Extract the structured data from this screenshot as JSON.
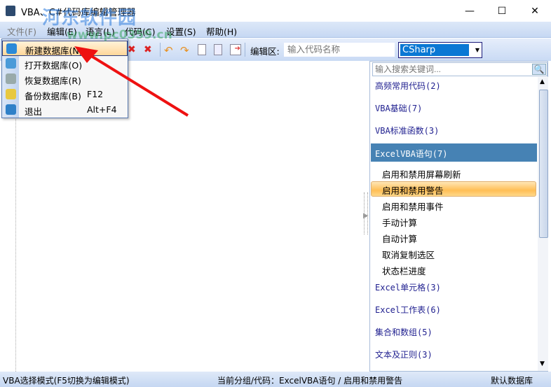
{
  "window": {
    "title": "VBA、C#代码库编辑管理器",
    "minimize": "—",
    "maximize": "☐",
    "close": "✕"
  },
  "watermark": {
    "name": "河东软件园",
    "url": "www.pc0359.cn"
  },
  "menu": [
    "文件(F)",
    "编辑(E)",
    "语言(L)",
    "代码(C)",
    "设置(S)",
    "帮助(H)"
  ],
  "toolbar": {
    "edit_label": "编辑区:",
    "code_placeholder": "输入代码名称",
    "language": "CSharp"
  },
  "file_menu": [
    {
      "label": "新建数据库(N)",
      "shortcut": ""
    },
    {
      "label": "打开数据库(O)",
      "shortcut": ""
    },
    {
      "label": "恢复数据库(R)",
      "shortcut": ""
    },
    {
      "label": "备份数据库(B)",
      "shortcut": "F12"
    },
    {
      "label": "退出",
      "shortcut": "Alt+F4"
    }
  ],
  "panel": {
    "search_placeholder": "输入搜索关键词...",
    "categories": [
      "高频常用代码(2)",
      "VBA基础(7)",
      "VBA标准函数(3)",
      "ExcelVBA语句(7)",
      "Excel单元格(3)",
      "Excel工作表(6)",
      "集合和数组(5)",
      "文本及正则(3)"
    ],
    "items": [
      "启用和禁用屏幕刷新",
      "启用和禁用警告",
      "启用和禁用事件",
      "手动计算",
      "自动计算",
      "取消复制选区",
      "状态栏进度"
    ]
  },
  "status": {
    "mode": "VBA选择模式(F5切换为编辑模式)",
    "current": "当前分组/代码：ExcelVBA语句 / 启用和禁用警告",
    "db": "默认数据库"
  },
  "colors": {
    "selected_category": "#4682b4",
    "highlight": "#ffbe55",
    "accent": "#0a78d4"
  }
}
